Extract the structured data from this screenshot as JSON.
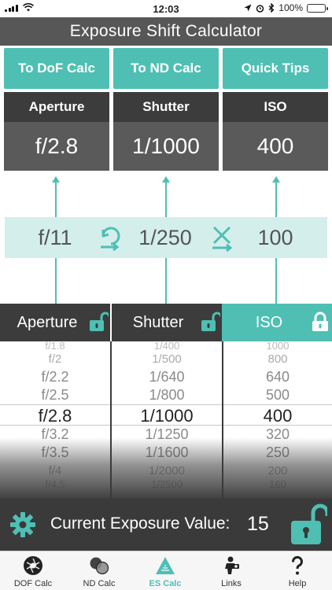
{
  "status_bar": {
    "time": "12:03",
    "battery_text": "100%"
  },
  "title": "Exposure Shift Calculator",
  "top_buttons": [
    {
      "label": "To DoF Calc"
    },
    {
      "label": "To ND Calc"
    },
    {
      "label": "Quick Tips"
    }
  ],
  "parameters": [
    {
      "label": "Aperture",
      "value": "f/2.8"
    },
    {
      "label": "Shutter",
      "value": "1/1000"
    },
    {
      "label": "ISO",
      "value": "400"
    }
  ],
  "shift_row": {
    "aperture": "f/11",
    "shutter": "1/250",
    "iso": "100",
    "icons": [
      "rotate-swap-icon",
      "cross-swap-icon"
    ]
  },
  "pickers": [
    {
      "label": "Aperture",
      "locked": false,
      "items": [
        "f/1.8",
        "f/2",
        "f/2.2",
        "f/2.5",
        "f/2.8",
        "f/3.2",
        "f/3.5",
        "f/4",
        "f/4.5"
      ],
      "selected": "f/2.8"
    },
    {
      "label": "Shutter",
      "locked": false,
      "items": [
        "1/400",
        "1/500",
        "1/640",
        "1/800",
        "1/1000",
        "1/1250",
        "1/1600",
        "1/2000",
        "1/2500"
      ],
      "selected": "1/1000"
    },
    {
      "label": "ISO",
      "locked": true,
      "items": [
        "1000",
        "800",
        "640",
        "500",
        "400",
        "320",
        "250",
        "200",
        "160"
      ],
      "selected": "400"
    }
  ],
  "exposure": {
    "label": "Current Exposure Value:",
    "value": "15"
  },
  "tabs": [
    {
      "label": "DOF Calc",
      "icon": "aperture-icon",
      "active": false
    },
    {
      "label": "ND Calc",
      "icon": "nd-filter-icon",
      "active": false
    },
    {
      "label": "ES Calc",
      "icon": "es-triangle-icon",
      "active": true
    },
    {
      "label": "Links",
      "icon": "links-icon",
      "active": false
    },
    {
      "label": "Help",
      "icon": "help-icon",
      "active": false
    }
  ],
  "colors": {
    "accent": "#4fbfb4",
    "dark": "#3a3a3a",
    "title_bg": "#575757",
    "shift_bg": "#d4eeec"
  }
}
